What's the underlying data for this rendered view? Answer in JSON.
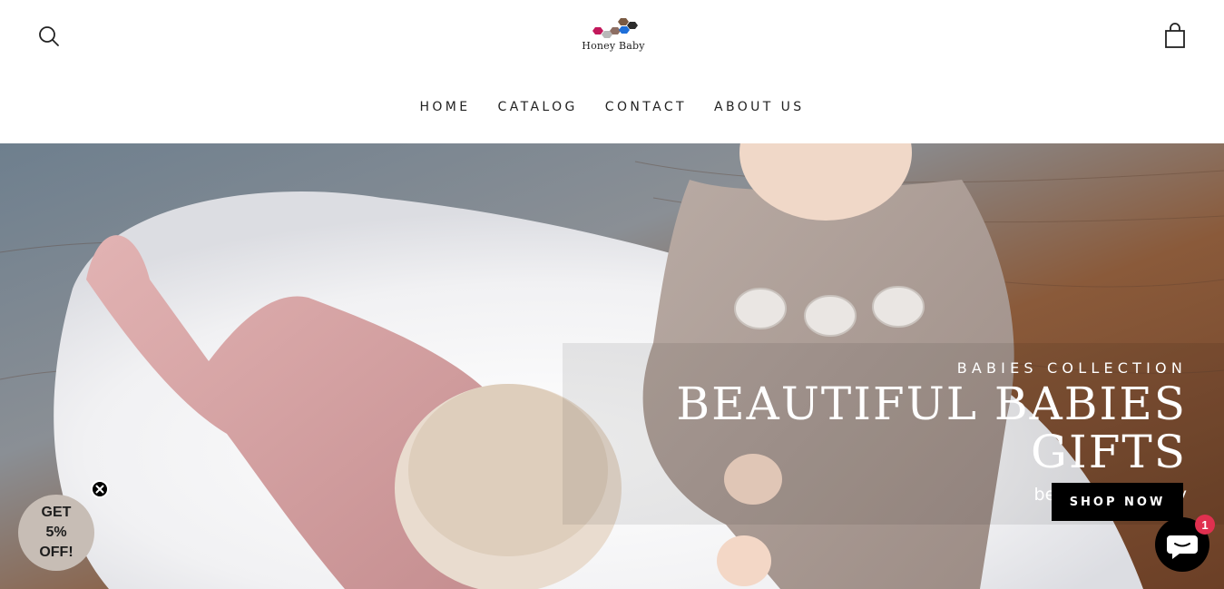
{
  "header": {
    "logo_text": "Honey Baby"
  },
  "nav": {
    "items": [
      {
        "label": "HOME"
      },
      {
        "label": "CATALOG"
      },
      {
        "label": "CONTACT"
      },
      {
        "label": "ABOUT US"
      }
    ]
  },
  "hero": {
    "kicker": "BABIES COLLECTION",
    "title": "BEAUTIFUL BABIES GIFTS",
    "subtitle": "beautiful imagery",
    "cta_label": "SHOP NOW"
  },
  "discount_popup": {
    "line1": "GET",
    "line2": "5%",
    "line3": "OFF!"
  },
  "chat": {
    "badge_count": "1"
  },
  "icons": {
    "search": "search-icon",
    "cart": "shopping-bag-icon",
    "close": "close-icon",
    "chat": "chat-bubble-icon"
  },
  "colors": {
    "accent": "#000000",
    "badge": "#e0304f",
    "discount_bg": "#c7bdb5",
    "logo_pink": "#c2185b",
    "logo_blue": "#1e6fd9",
    "logo_brown": "#7a5a43",
    "logo_dark": "#2c2c2c"
  }
}
